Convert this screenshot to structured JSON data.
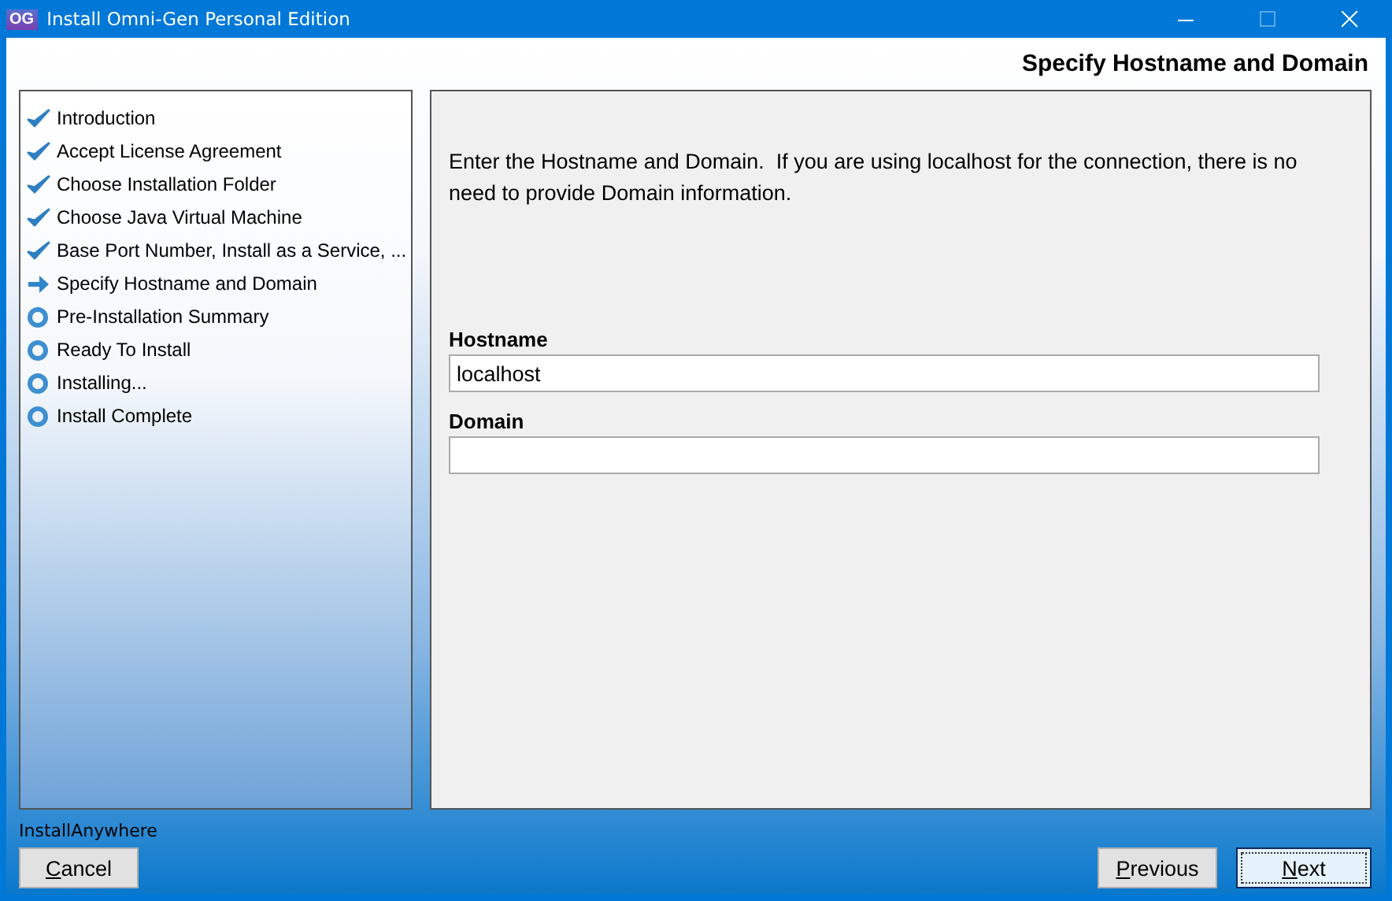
{
  "window": {
    "title": "Install Omni-Gen Personal Edition",
    "app_icon": "OG"
  },
  "heading": "Specify Hostname and Domain",
  "steps": [
    {
      "label": "Introduction",
      "kind": "done"
    },
    {
      "label": "Accept License Agreement",
      "kind": "done"
    },
    {
      "label": "Choose Installation Folder",
      "kind": "done"
    },
    {
      "label": "Choose Java Virtual Machine",
      "kind": "done"
    },
    {
      "label": "Base Port Number, Install as a Service, ...",
      "kind": "done"
    },
    {
      "label": "Specify Hostname and Domain",
      "kind": "current"
    },
    {
      "label": "Pre-Installation Summary",
      "kind": "pending"
    },
    {
      "label": "Ready To Install",
      "kind": "pending"
    },
    {
      "label": "Installing...",
      "kind": "pending"
    },
    {
      "label": "Install Complete",
      "kind": "pending"
    }
  ],
  "instructions": "Enter the Hostname and Domain.  If you are using localhost for the connection, there is no need to provide Domain information.",
  "fields": [
    {
      "label": "Hostname",
      "value": "localhost"
    },
    {
      "label": "Domain"
    }
  ],
  "vendor": "InstallAnywhere",
  "buttons": {
    "cancel": {
      "label": "Cancel",
      "focused": false
    },
    "previous": {
      "label": "Previous",
      "focused": false
    },
    "next": {
      "label": "Next",
      "focused": true
    }
  }
}
